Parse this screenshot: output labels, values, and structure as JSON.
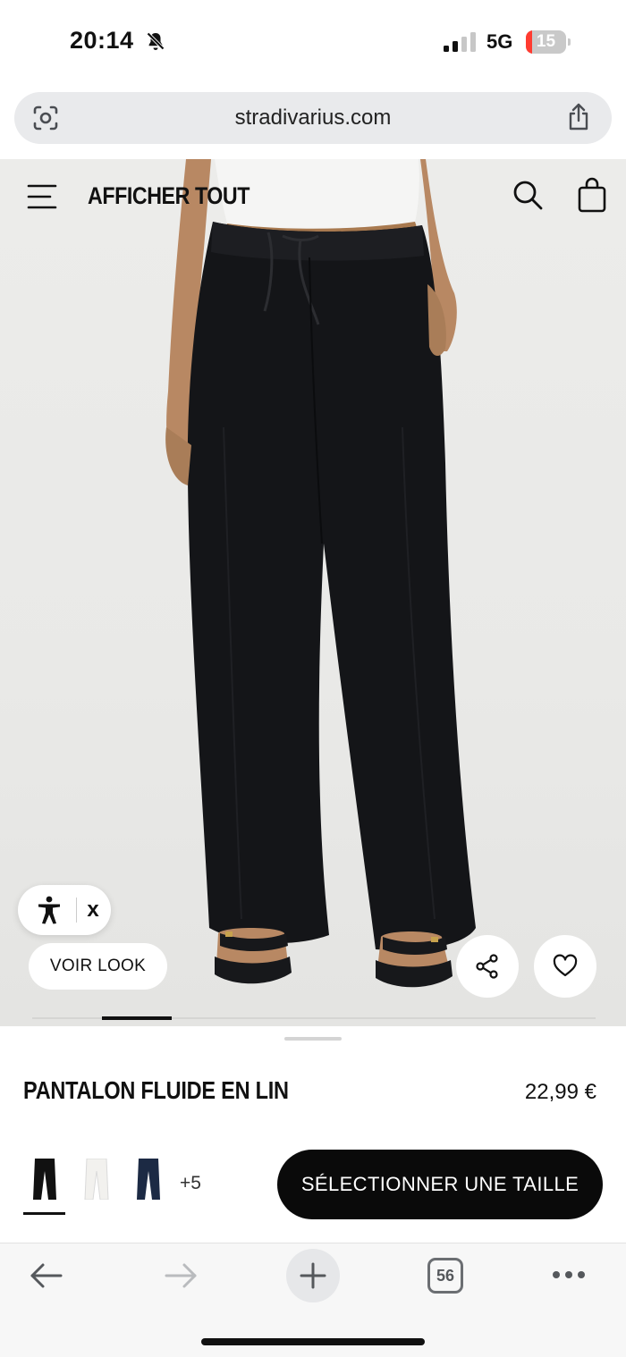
{
  "status_bar": {
    "time": "20:14",
    "network": "5G",
    "battery_level": "15",
    "battery_fraction": 0.15,
    "icons": [
      "bell-muted-icon",
      "signal-icon",
      "battery-icon"
    ]
  },
  "browser": {
    "url": "stradivarius.com",
    "tab_count": "56",
    "icons": [
      "lens-icon",
      "share-icon",
      "back-arrow-icon",
      "forward-arrow-icon",
      "plus-icon",
      "tabs-icon",
      "more-icon"
    ]
  },
  "nav": {
    "title": "AFFICHER TOUT",
    "icons": [
      "menu-icon",
      "search-icon",
      "bag-icon"
    ]
  },
  "hero": {
    "accessibility_close": "x",
    "voir_look": "VOIR LOOK",
    "gallery_position": 0.13,
    "icons": [
      "accessibility-icon",
      "share-icon",
      "heart-icon"
    ]
  },
  "product": {
    "name": "PANTALON FLUIDE EN LIN",
    "price": "22,99 €",
    "more_colors": "+5",
    "select_size": "SÉLECTIONNER UNE TAILLE",
    "swatch_colors": [
      "#111111",
      "#f2f1ee",
      "#1c2a44"
    ]
  },
  "colors": {
    "accent": "#0a0a0a",
    "battery_low": "#ff3b30"
  }
}
